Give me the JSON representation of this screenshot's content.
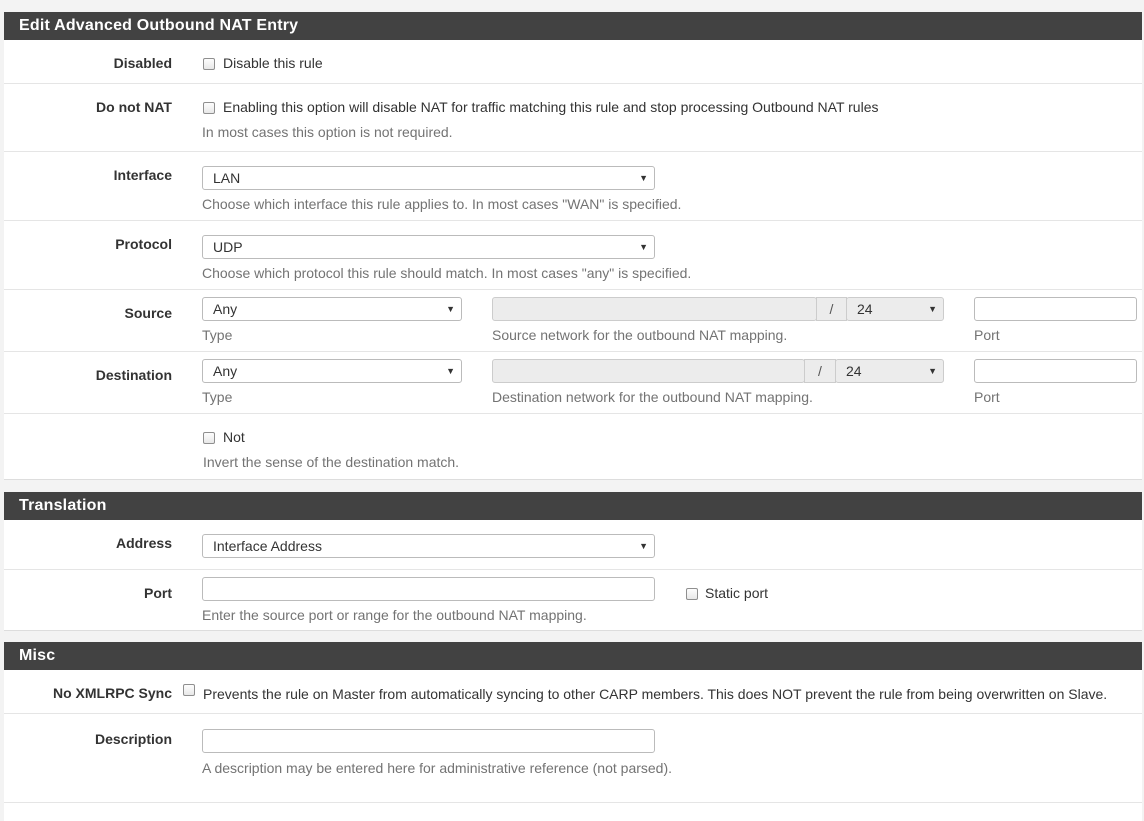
{
  "edit_panel": {
    "title": "Edit Advanced Outbound NAT Entry",
    "disabled": {
      "label": "Disabled",
      "checkbox_text": "Disable this rule"
    },
    "nonat": {
      "label": "Do not NAT",
      "checkbox_text": "Enabling this option will disable NAT for traffic matching this rule and stop processing Outbound NAT rules",
      "help": "In most cases this option is not required."
    },
    "interface": {
      "label": "Interface",
      "value": "LAN",
      "help": "Choose which interface this rule applies to. In most cases \"WAN\" is specified."
    },
    "protocol": {
      "label": "Protocol",
      "value": "UDP",
      "help": "Choose which protocol this rule should match. In most cases \"any\" is specified."
    },
    "source": {
      "label": "Source",
      "type_value": "Any",
      "type_help": "Type",
      "slash": "/",
      "mask_value": "24",
      "network_help": "Source network for the outbound NAT mapping.",
      "port_help": "Port"
    },
    "destination": {
      "label": "Destination",
      "type_value": "Any",
      "type_help": "Type",
      "slash": "/",
      "mask_value": "24",
      "network_help": "Destination network for the outbound NAT mapping.",
      "port_help": "Port"
    },
    "not": {
      "checkbox_text": "Not",
      "help": "Invert the sense of the destination match."
    }
  },
  "translation_panel": {
    "title": "Translation",
    "address": {
      "label": "Address",
      "value": "Interface Address"
    },
    "port": {
      "label": "Port",
      "static_port_text": "Static port",
      "help": "Enter the source port or range for the outbound NAT mapping."
    }
  },
  "misc_panel": {
    "title": "Misc",
    "xmlrpc": {
      "label": "No XMLRPC Sync",
      "checkbox_text": "Prevents the rule on Master from automatically syncing to other CARP members. This does NOT prevent the rule from being overwritten on Slave."
    },
    "description": {
      "label": "Description",
      "help": "A description may be entered here for administrative reference (not parsed)."
    }
  },
  "icons": {
    "dropdown": "chevron-down-icon"
  }
}
